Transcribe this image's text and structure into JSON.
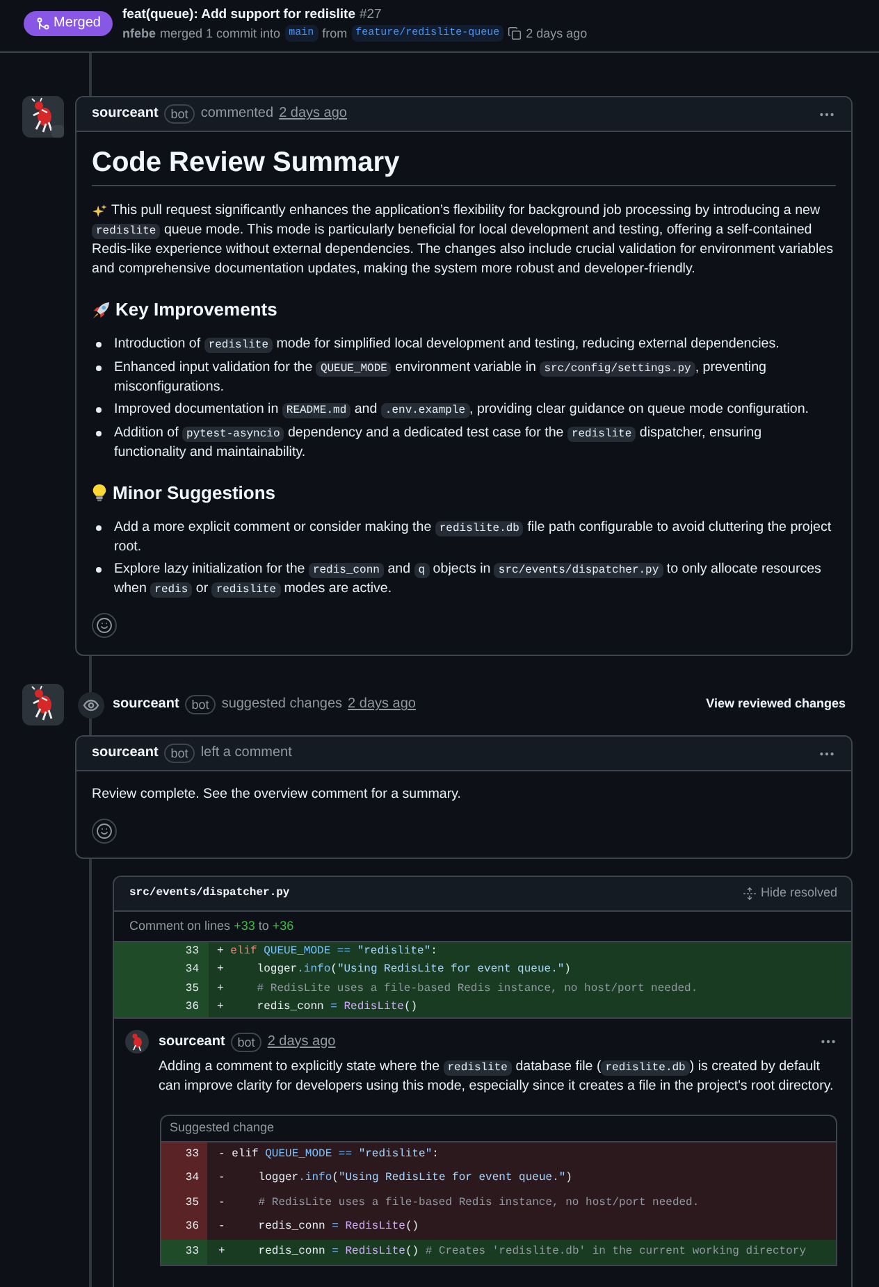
{
  "header": {
    "state": "Merged",
    "title": "feat(queue): Add support for redislite",
    "number": "#27",
    "author": "nfebe",
    "action": "merged 1 commit into",
    "base_branch": "main",
    "from_label": "from",
    "head_branch": "feature/redislite-queue",
    "time": "2 days ago"
  },
  "summary_comment": {
    "author": "sourceant",
    "badge": "bot",
    "action": "commented",
    "time": "2 days ago",
    "title": "Code Review Summary",
    "intro": [
      {
        "kind": "text",
        "text": "This pull request significantly enhances the application’s flexibility for background job processing by introducing a new "
      },
      {
        "kind": "code",
        "text": "redislite"
      },
      {
        "kind": "text",
        "text": " queue mode. This mode is particularly beneficial for local development and testing, offering a self-contained Redis-like experience without external dependencies. The changes also include crucial validation for environment variables and comprehensive documentation updates, making the system more robust and developer-friendly."
      }
    ],
    "sections": [
      {
        "heading": "Key Improvements",
        "items": [
          [
            {
              "kind": "text",
              "text": "Introduction of "
            },
            {
              "kind": "code",
              "text": "redislite"
            },
            {
              "kind": "text",
              "text": " mode for simplified local development and testing, reducing external dependencies."
            }
          ],
          [
            {
              "kind": "text",
              "text": "Enhanced input validation for the "
            },
            {
              "kind": "code",
              "text": "QUEUE_MODE"
            },
            {
              "kind": "text",
              "text": " environment variable in "
            },
            {
              "kind": "code",
              "text": "src/config/settings.py"
            },
            {
              "kind": "text",
              "text": ", preventing misconfigurations."
            }
          ],
          [
            {
              "kind": "text",
              "text": "Improved documentation in "
            },
            {
              "kind": "code",
              "text": "README.md"
            },
            {
              "kind": "text",
              "text": " and "
            },
            {
              "kind": "code",
              "text": ".env.example"
            },
            {
              "kind": "text",
              "text": ", providing clear guidance on queue mode configuration."
            }
          ],
          [
            {
              "kind": "text",
              "text": "Addition of "
            },
            {
              "kind": "code",
              "text": "pytest-asyncio"
            },
            {
              "kind": "text",
              "text": " dependency and a dedicated test case for the "
            },
            {
              "kind": "code",
              "text": "redislite"
            },
            {
              "kind": "text",
              "text": " dispatcher, ensuring functionality and maintainability."
            }
          ]
        ]
      },
      {
        "heading": "Minor Suggestions",
        "items": [
          [
            {
              "kind": "text",
              "text": "Add a more explicit comment or consider making the "
            },
            {
              "kind": "code",
              "text": "redislite.db"
            },
            {
              "kind": "text",
              "text": " file path configurable to avoid cluttering the project root."
            }
          ],
          [
            {
              "kind": "text",
              "text": "Explore lazy initialization for the "
            },
            {
              "kind": "code",
              "text": "redis_conn"
            },
            {
              "kind": "text",
              "text": " and "
            },
            {
              "kind": "code",
              "text": "q"
            },
            {
              "kind": "text",
              "text": " objects in "
            },
            {
              "kind": "code",
              "text": "src/events/dispatcher.py"
            },
            {
              "kind": "text",
              "text": " to only allocate resources when "
            },
            {
              "kind": "code",
              "text": "redis"
            },
            {
              "kind": "text",
              "text": " or "
            },
            {
              "kind": "code",
              "text": "redislite"
            },
            {
              "kind": "text",
              "text": " modes are active."
            }
          ]
        ]
      }
    ]
  },
  "review": {
    "author": "sourceant",
    "badge": "bot",
    "action": "suggested changes",
    "time": "2 days ago",
    "view_button": "View reviewed changes",
    "comment": {
      "author": "sourceant",
      "badge": "bot",
      "action": "left a comment",
      "body": "Review complete. See the overview comment for a summary."
    },
    "thread": {
      "file": "src/events/dispatcher.py",
      "hide_button": "Hide resolved",
      "range": {
        "prefix": "Comment on lines",
        "start": "+33",
        "joiner": "to",
        "end": "+36"
      },
      "lines": [
        {
          "number": "33",
          "sign": "+",
          "kind": "added",
          "tokens": [
            {
              "kind": "keyword",
              "text": "elif "
            },
            {
              "kind": "constant",
              "text": "QUEUE_MODE"
            },
            {
              "kind": "operator",
              "text": " == "
            },
            {
              "kind": "string",
              "text": "\"redislite\""
            },
            {
              "kind": "plain",
              "text": ":"
            }
          ]
        },
        {
          "number": "34",
          "sign": "+",
          "kind": "added",
          "tokens": [
            {
              "kind": "plain",
              "text": "    logger"
            },
            {
              "kind": "method",
              "text": ".info"
            },
            {
              "kind": "plain",
              "text": "("
            },
            {
              "kind": "string",
              "text": "\"Using RedisLite for event queue.\""
            },
            {
              "kind": "plain",
              "text": ")"
            }
          ]
        },
        {
          "number": "35",
          "sign": "+",
          "kind": "added",
          "tokens": [
            {
              "kind": "comment",
              "text": "    # RedisLite uses a file-based Redis instance, no host/port needed."
            }
          ]
        },
        {
          "number": "36",
          "sign": "+",
          "kind": "added",
          "tokens": [
            {
              "kind": "plain",
              "text": "    redis_conn"
            },
            {
              "kind": "operator",
              "text": " = "
            },
            {
              "kind": "class",
              "text": "RedisLite"
            },
            {
              "kind": "plain",
              "text": "()"
            }
          ]
        }
      ],
      "reply": {
        "author": "sourceant",
        "badge": "bot",
        "time": "2 days ago",
        "body": [
          {
            "kind": "text",
            "text": "Adding a comment to explicitly state where the "
          },
          {
            "kind": "code",
            "text": "redislite"
          },
          {
            "kind": "text",
            "text": " database file ("
          },
          {
            "kind": "code",
            "text": "redislite.db"
          },
          {
            "kind": "text",
            "text": ") is created by default can improve clarity for developers using this mode, especially since it creates a file in the project's root directory."
          }
        ],
        "suggestion": {
          "title": "Suggested change",
          "lines": [
            {
              "number": "33",
              "sign": "-",
              "kind": "deleted",
              "tokens": [
                {
                  "kind": "plain",
                  "text": "elif "
                },
                {
                  "kind": "constant",
                  "text": "QUEUE_MODE"
                },
                {
                  "kind": "operator",
                  "text": " == "
                },
                {
                  "kind": "string",
                  "text": "\"redislite\""
                },
                {
                  "kind": "plain",
                  "text": ":"
                }
              ]
            },
            {
              "number": "34",
              "sign": "-",
              "kind": "deleted",
              "tokens": [
                {
                  "kind": "plain",
                  "text": "    logger"
                },
                {
                  "kind": "method",
                  "text": ".info"
                },
                {
                  "kind": "plain",
                  "text": "("
                },
                {
                  "kind": "string",
                  "text": "\"Using RedisLite for event queue.\""
                },
                {
                  "kind": "plain",
                  "text": ")"
                }
              ]
            },
            {
              "number": "35",
              "sign": "-",
              "kind": "deleted",
              "tokens": [
                {
                  "kind": "comment",
                  "text": "    # RedisLite uses a file-based Redis instance, no host/port needed."
                }
              ]
            },
            {
              "number": "36",
              "sign": "-",
              "kind": "deleted",
              "tokens": [
                {
                  "kind": "plain",
                  "text": "    redis_conn"
                },
                {
                  "kind": "operator",
                  "text": " = "
                },
                {
                  "kind": "class",
                  "text": "RedisLite"
                },
                {
                  "kind": "plain",
                  "text": "()"
                }
              ]
            },
            {
              "number": "33",
              "sign": "+",
              "kind": "added",
              "tokens": [
                {
                  "kind": "plain",
                  "text": "    redis_conn"
                },
                {
                  "kind": "operator",
                  "text": " = "
                },
                {
                  "kind": "class",
                  "text": "RedisLite"
                },
                {
                  "kind": "plain",
                  "text": "()"
                },
                {
                  "kind": "comment",
                  "text": " # Creates 'redislite.db' in the current working directory"
                }
              ]
            }
          ]
        }
      }
    }
  }
}
